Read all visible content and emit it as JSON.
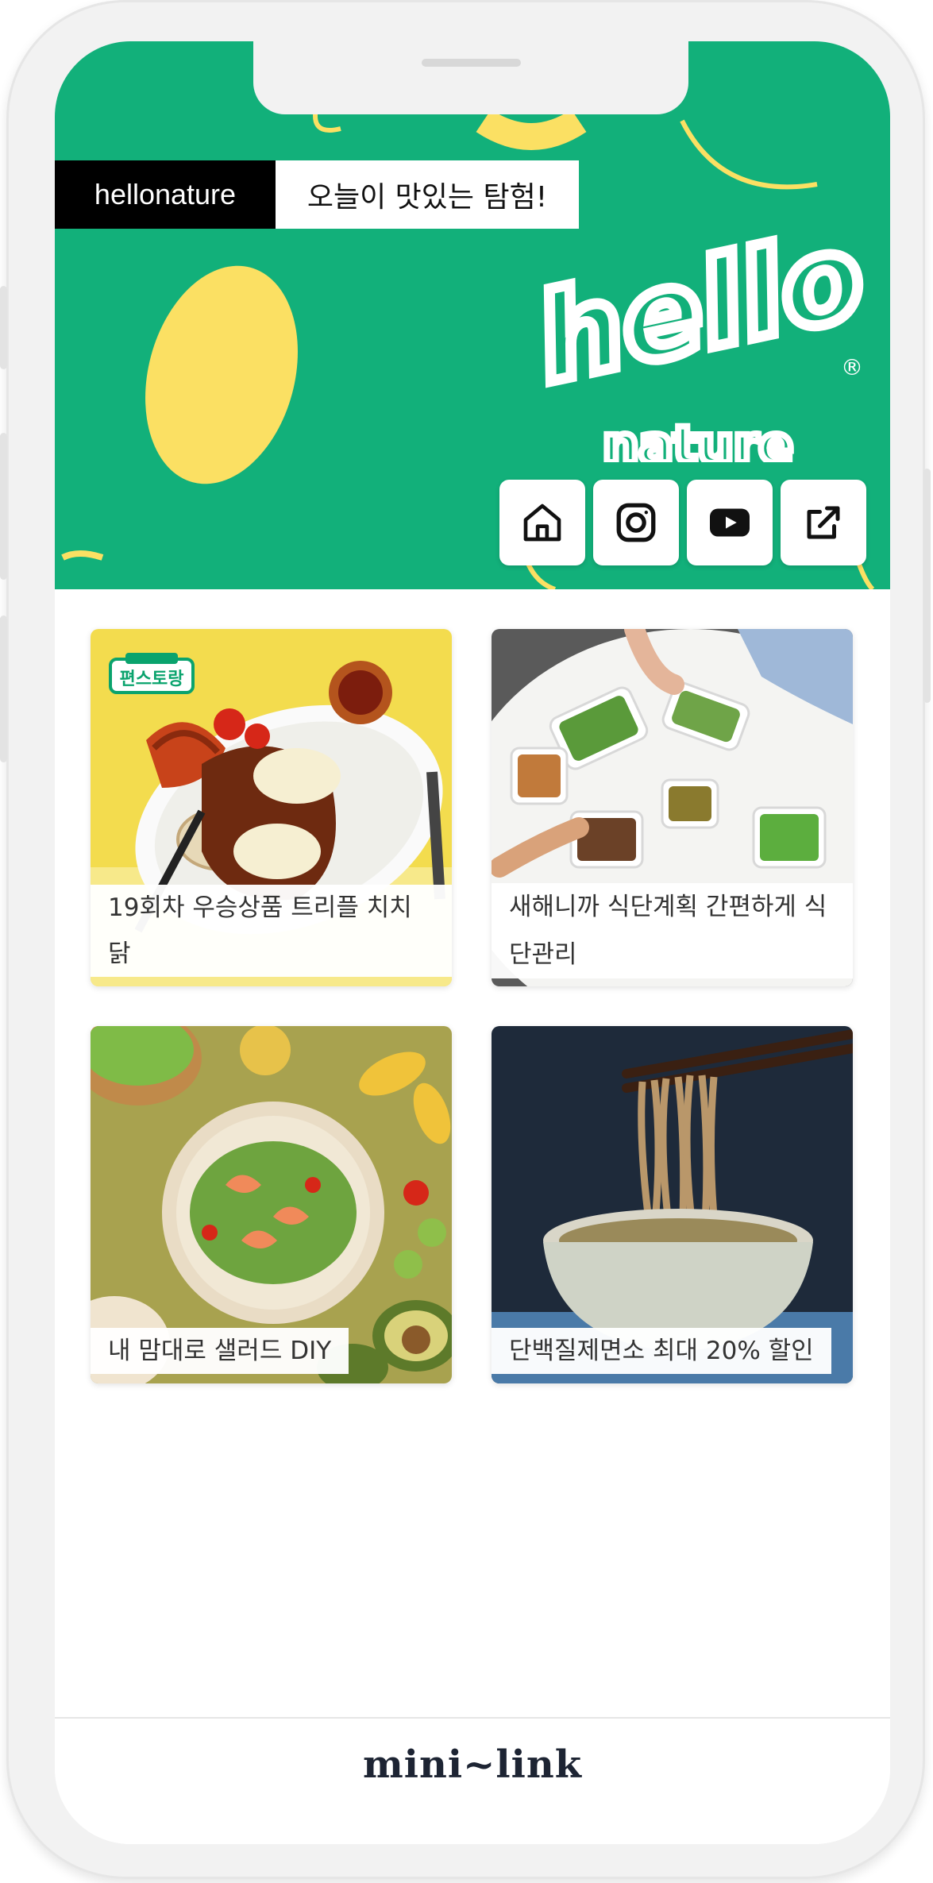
{
  "header": {
    "brand": "hellonature",
    "tagline": "오늘이 맛있는 탐험!",
    "logo_text_top": "hello",
    "logo_text_bottom": "nature",
    "registered_mark": "®"
  },
  "social_links": [
    {
      "icon": "home-icon"
    },
    {
      "icon": "instagram-icon"
    },
    {
      "icon": "youtube-icon"
    },
    {
      "icon": "external-link-icon"
    }
  ],
  "cards": [
    {
      "caption": "19회차 우승상품 트리플 치치닭",
      "badge": "편스토랑",
      "image": "roast-chicken-plate"
    },
    {
      "caption": "새해니까 식단계획 간편하게 식단관리",
      "image": "meal-prep-containers"
    },
    {
      "caption": "내 맘대로 샐러드 DIY",
      "image": "shrimp-salad-bowl"
    },
    {
      "caption": "단백질제면소 최대 20% 할인",
      "image": "noodle-bowl"
    }
  ],
  "footer": {
    "logo": "mini~link"
  },
  "colors": {
    "hero_green": "#12b07a",
    "accent_yellow": "#fbe063",
    "footer_text": "#1d2433"
  }
}
